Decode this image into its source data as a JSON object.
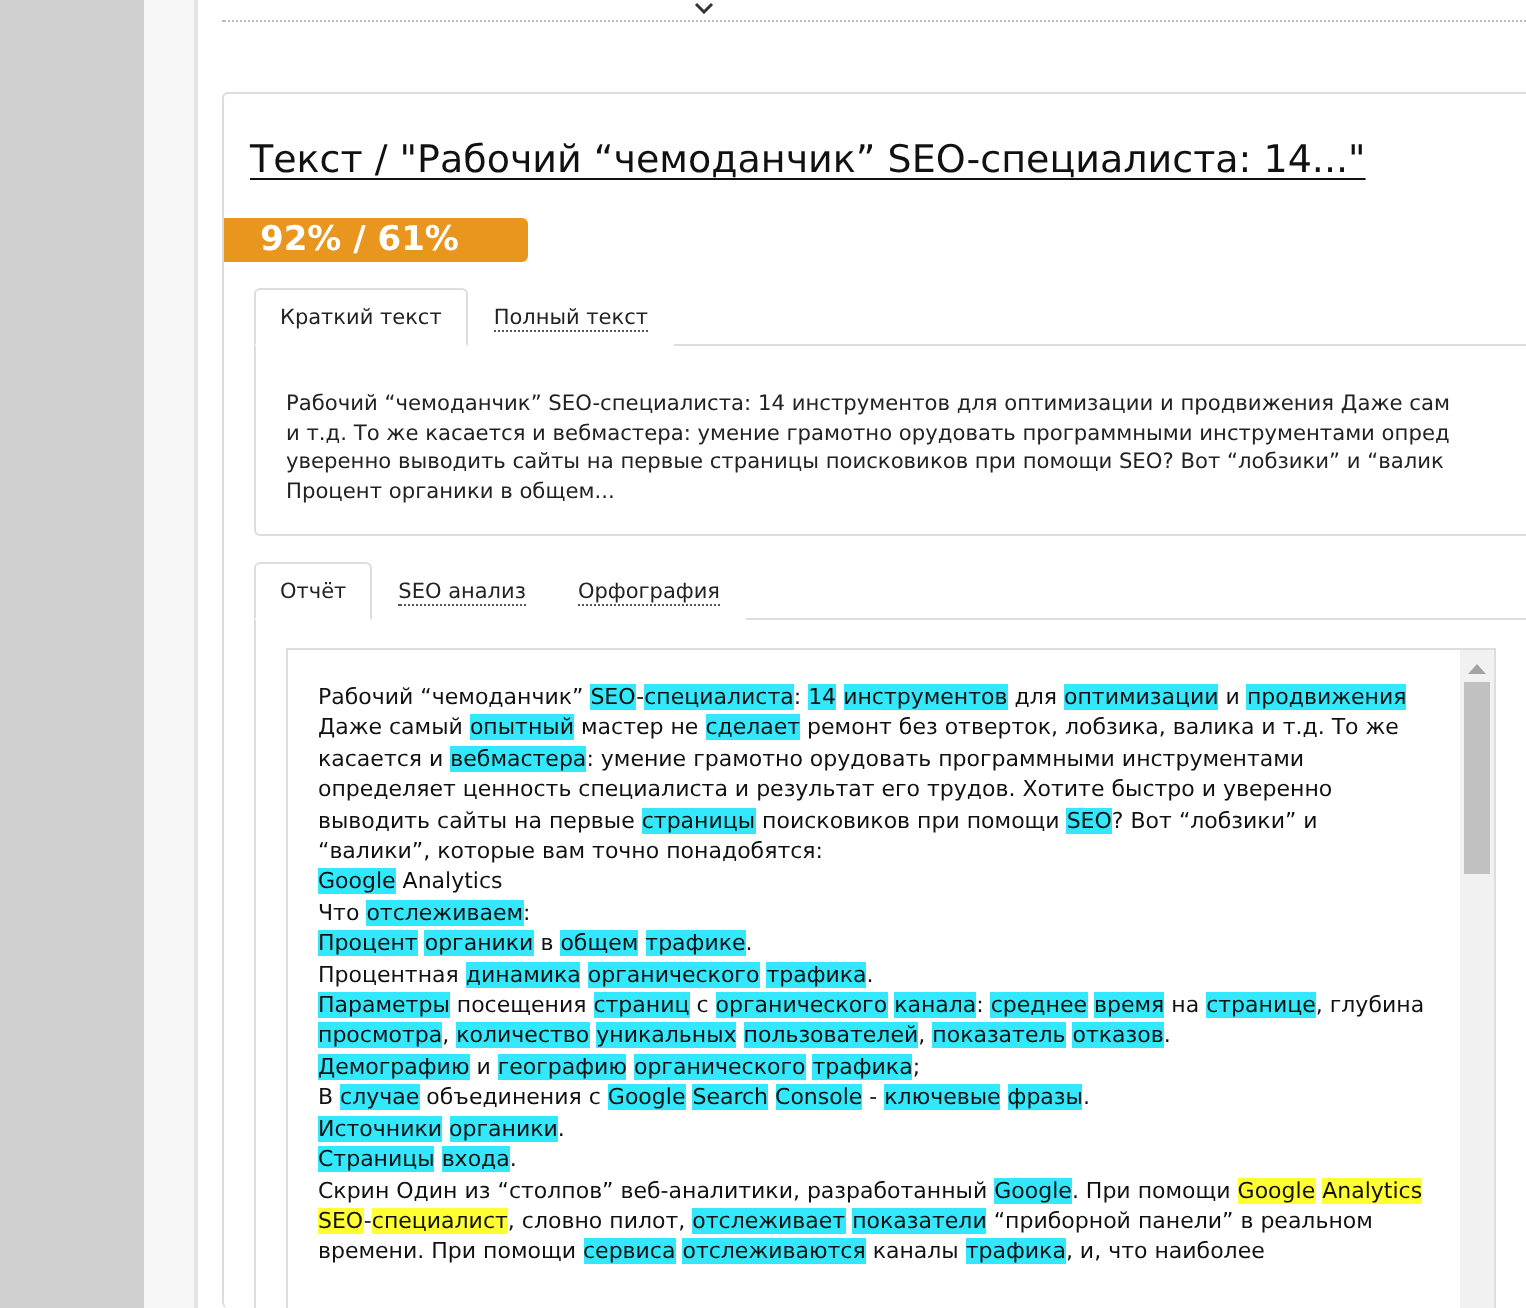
{
  "title": "Текст / \"Рабочий “чемоданчик” SEO-специалиста: 14...\"",
  "score_badge": "92% / 61%",
  "text_tabs": [
    {
      "label": "Краткий текст",
      "selected": true
    },
    {
      "label": "Полный текст",
      "selected": false
    }
  ],
  "summary_lines": [
    "Рабочий “чемоданчик” SEO-специалиста: 14 инструментов для оптимизации и продвижения Даже сам",
    "и т.д. То же касается и вебмастера: умение грамотно орудовать программными инструментами опред",
    "уверенно выводить сайты на первые страницы поисковиков при помощи SEO? Вот “лобзики” и “валик",
    "Процент органики в общем..."
  ],
  "report_tabs": [
    {
      "label": "Отчёт",
      "selected": true
    },
    {
      "label": "SEO анализ",
      "selected": false
    },
    {
      "label": "Орфография",
      "selected": false
    }
  ],
  "report_paragraphs": [
    [
      {
        "text": "Рабочий “чемоданчик” "
      },
      {
        "text": "SEO",
        "color": "#33e8fc"
      },
      {
        "text": "-"
      },
      {
        "text": "специалиста",
        "color": "#33e8fc"
      },
      {
        "text": ": "
      },
      {
        "text": "14 инструментов",
        "color": "#33e8fc"
      },
      {
        "text": " для "
      },
      {
        "text": "оптимизации",
        "color": "#33e8fc"
      },
      {
        "text": " и "
      },
      {
        "text": "продвижения",
        "color": "#33e8fc"
      }
    ],
    [
      {
        "text": "Даже самый "
      },
      {
        "text": "опытный",
        "color": "#33e8fc"
      },
      {
        "text": " мастер не "
      },
      {
        "text": "сделает",
        "color": "#33e8fc"
      },
      {
        "text": " ремонт без отверток, лобзика, валика и т.д. То же касается и "
      },
      {
        "text": "вебмастера",
        "color": "#33e8fc"
      },
      {
        "text": ": умение грамотно орудовать программными инструментами определяет ценность специалиста и результат его трудов. Хотите быстро и уверенно выводить сайты на первые "
      },
      {
        "text": "страницы",
        "color": "#33e8fc"
      },
      {
        "text": " поисковиков при помощи "
      },
      {
        "text": "SEO",
        "color": "#33e8fc"
      },
      {
        "text": "? Вот “лобзики” и “валики”, которые вам точно понадобятся:"
      }
    ],
    [
      {
        "text": "Google",
        "color": "#33e8fc"
      },
      {
        "text": " Analytics"
      }
    ],
    [
      {
        "text": "Что "
      },
      {
        "text": "отслеживаем",
        "color": "#33e8fc"
      },
      {
        "text": ":"
      }
    ],
    [
      {
        "text": "Процент органики",
        "color": "#33e8fc"
      },
      {
        "text": " в "
      },
      {
        "text": "общем трафике",
        "color": "#33e8fc"
      },
      {
        "text": "."
      }
    ],
    [
      {
        "text": "Процентная "
      },
      {
        "text": "динамика органического трафика",
        "color": "#33e8fc"
      },
      {
        "text": "."
      }
    ],
    [
      {
        "text": "Параметры",
        "color": "#33e8fc"
      },
      {
        "text": " посещения "
      },
      {
        "text": "страниц",
        "color": "#33e8fc"
      },
      {
        "text": " с "
      },
      {
        "text": "органического канала",
        "color": "#33e8fc"
      },
      {
        "text": ": "
      },
      {
        "text": "среднее время",
        "color": "#33e8fc"
      },
      {
        "text": " на "
      },
      {
        "text": "странице",
        "color": "#33e8fc"
      },
      {
        "text": ", глубина "
      },
      {
        "text": "просмотра",
        "color": "#33e8fc"
      },
      {
        "text": ", "
      },
      {
        "text": "количество уникальных пользователей",
        "color": "#33e8fc"
      },
      {
        "text": ", "
      },
      {
        "text": "показатель отказов",
        "color": "#33e8fc"
      },
      {
        "text": "."
      }
    ],
    [
      {
        "text": "Демографию",
        "color": "#33e8fc"
      },
      {
        "text": " и "
      },
      {
        "text": "географию органического трафика",
        "color": "#33e8fc"
      },
      {
        "text": ";"
      }
    ],
    [
      {
        "text": "В "
      },
      {
        "text": "случае",
        "color": "#33e8fc"
      },
      {
        "text": " объединения с "
      },
      {
        "text": "Google Search Console",
        "color": "#33e8fc"
      },
      {
        "text": " - "
      },
      {
        "text": "ключевые фразы",
        "color": "#33e8fc"
      },
      {
        "text": "."
      }
    ],
    [
      {
        "text": "Источники органики",
        "color": "#33e8fc"
      },
      {
        "text": "."
      }
    ],
    [
      {
        "text": "Страницы входа",
        "color": "#33e8fc"
      },
      {
        "text": "."
      }
    ],
    [
      {
        "text": "Скрин Один из “столпов” веб-аналитики, разработанный "
      },
      {
        "text": "Google",
        "color": "#33e8fc"
      },
      {
        "text": ". При помощи "
      },
      {
        "text": "Google Analytics SEO",
        "color": "#ffff33"
      },
      {
        "text": "-"
      },
      {
        "text": "специалист",
        "color": "#ffff33"
      },
      {
        "text": ", словно пилот, "
      },
      {
        "text": "отслеживает показатели",
        "color": "#33e8fc"
      },
      {
        "text": " “приборной панели” в реальном времени. При помощи "
      },
      {
        "text": "сервиса отслеживаются",
        "color": "#33e8fc"
      },
      {
        "text": " каналы "
      },
      {
        "text": "трафика",
        "color": "#33e8fc"
      },
      {
        "text": ", и, что наиболее"
      }
    ]
  ]
}
